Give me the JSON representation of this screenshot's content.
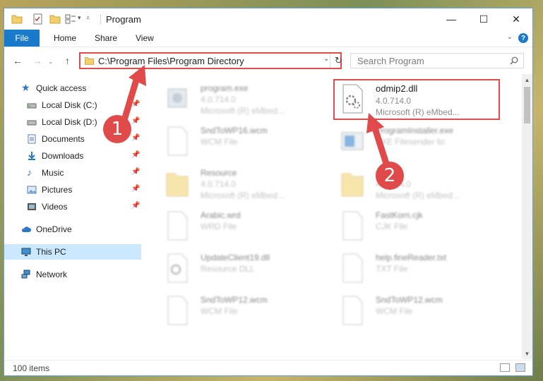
{
  "window": {
    "title": "Program",
    "controls": {
      "minimize": "—",
      "maximize": "☐",
      "close": "✕"
    }
  },
  "ribbon": {
    "tabs": [
      "File",
      "Home",
      "Share",
      "View"
    ],
    "help": "?"
  },
  "address": {
    "path": "C:\\Program Files\\Program Directory",
    "refresh": "↻",
    "dropdown": "⌄"
  },
  "search": {
    "placeholder": "Search Program"
  },
  "sidebar": {
    "items": [
      {
        "label": "Quick access",
        "icon": "star-icon"
      },
      {
        "label": "Local Disk (C:)",
        "icon": "drive-icon"
      },
      {
        "label": "Local Disk (D:)",
        "icon": "drive-icon"
      },
      {
        "label": "Documents",
        "icon": "documents-icon"
      },
      {
        "label": "Downloads",
        "icon": "download-icon"
      },
      {
        "label": "Music",
        "icon": "music-icon"
      },
      {
        "label": "Pictures",
        "icon": "pictures-icon"
      },
      {
        "label": "Videos",
        "icon": "videos-icon"
      },
      {
        "label": "OneDrive",
        "icon": "cloud-icon"
      },
      {
        "label": "This PC",
        "icon": "computer-icon"
      },
      {
        "label": "Network",
        "icon": "network-icon"
      }
    ]
  },
  "files": [
    {
      "name": "program.exe",
      "line2": "4.0.714.0",
      "line3": "Microsoft (R) eMbed...",
      "icon": "exe-icon"
    },
    {
      "name": "odmip2.dll",
      "line2": "4.0.714.0",
      "line3": "Microsoft (R) eMbed...",
      "icon": "dll-icon"
    },
    {
      "name": "SndToWP16.wcm",
      "line2": "WCM File",
      "line3": "",
      "icon": "file-icon"
    },
    {
      "name": "ProgramInstaller.exe",
      "line2": "EXE Filesender tic",
      "line3": "",
      "icon": "installer-icon"
    },
    {
      "name": "Resource",
      "line2": "4.0.714.0",
      "line3": "Microsoft (R) eMbed...",
      "icon": "folder-icon"
    },
    {
      "name": "eMbed",
      "line2": "4.0.714.0",
      "line3": "Microsoft (R) eMbed...",
      "icon": "folder-icon"
    },
    {
      "name": "Arabic.wrd",
      "line2": "WRD File",
      "line3": "",
      "icon": "file-icon"
    },
    {
      "name": "FastKorn.cjk",
      "line2": "CJK File",
      "line3": "",
      "icon": "file-icon"
    },
    {
      "name": "UpdateClient19.dll",
      "line2": "Resource DLL",
      "line3": "",
      "icon": "dll-icon"
    },
    {
      "name": "help.fineReader.txt",
      "line2": "TXT File",
      "line3": "",
      "icon": "file-icon"
    },
    {
      "name": "SndToWP12.wcm",
      "line2": "WCM File",
      "line3": "",
      "icon": "file-icon"
    },
    {
      "name": "SndToWP12.wcm",
      "line2": "WCM File",
      "line3": "",
      "icon": "file-icon"
    }
  ],
  "annotations": [
    {
      "label": "1"
    },
    {
      "label": "2"
    }
  ],
  "status": {
    "items_count": "100 items"
  },
  "colors": {
    "accent": "#1979ca",
    "highlight": "#e04a4a",
    "selected": "#cce8ff"
  }
}
